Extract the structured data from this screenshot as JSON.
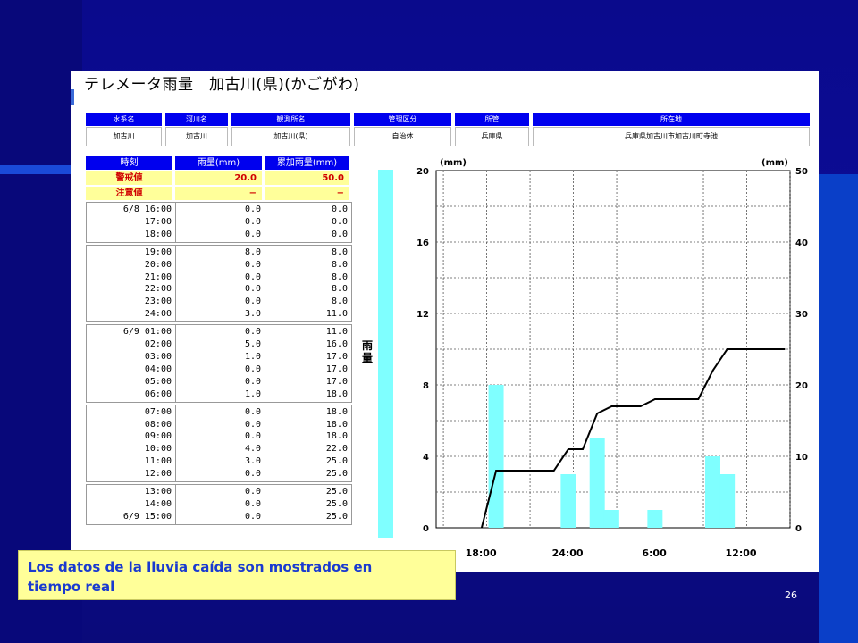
{
  "panel": {
    "title": "テレメータ雨量　加古川(県)(かごがわ)"
  },
  "station_info": {
    "headers": [
      "水系名",
      "河川名",
      "観測所名",
      "管理区分",
      "所管",
      "所在地"
    ],
    "values": [
      "加古川",
      "加古川",
      "加古川(県)",
      "自治体",
      "兵庫県",
      "兵庫県加古川市加古川町寺池"
    ]
  },
  "rain_table": {
    "headers": [
      "時刻",
      "雨量(mm)",
      "累加雨量(mm)"
    ],
    "warning": {
      "label": "警戒値",
      "rain": "20.0",
      "cumulative": "50.0"
    },
    "caution": {
      "label": "注意値",
      "rain": "−",
      "cumulative": "−"
    },
    "groups": [
      {
        "times": [
          "6/8 16:00",
          "17:00",
          "18:00"
        ],
        "rain": [
          "0.0",
          "0.0",
          "0.0"
        ],
        "cum": [
          "0.0",
          "0.0",
          "0.0"
        ]
      },
      {
        "times": [
          "19:00",
          "20:00",
          "21:00",
          "22:00",
          "23:00",
          "24:00"
        ],
        "rain": [
          "8.0",
          "0.0",
          "0.0",
          "0.0",
          "0.0",
          "3.0"
        ],
        "cum": [
          "8.0",
          "8.0",
          "8.0",
          "8.0",
          "8.0",
          "11.0"
        ]
      },
      {
        "times": [
          "6/9 01:00",
          "02:00",
          "03:00",
          "04:00",
          "05:00",
          "06:00"
        ],
        "rain": [
          "0.0",
          "5.0",
          "1.0",
          "0.0",
          "0.0",
          "1.0"
        ],
        "cum": [
          "11.0",
          "16.0",
          "17.0",
          "17.0",
          "17.0",
          "18.0"
        ]
      },
      {
        "times": [
          "07:00",
          "08:00",
          "09:00",
          "10:00",
          "11:00",
          "12:00"
        ],
        "rain": [
          "0.0",
          "0.0",
          "0.0",
          "4.0",
          "3.0",
          "0.0"
        ],
        "cum": [
          "18.0",
          "18.0",
          "18.0",
          "22.0",
          "25.0",
          "25.0"
        ]
      },
      {
        "times": [
          "13:00",
          "14:00",
          "6/9 15:00"
        ],
        "rain": [
          "0.0",
          "0.0",
          "0.0"
        ],
        "cum": [
          "25.0",
          "25.0",
          "25.0"
        ]
      }
    ]
  },
  "side_label": "雨量",
  "chart_data": {
    "type": "bar",
    "left_unit": "(mm)",
    "right_unit": "(mm)",
    "left_ylim": [
      0,
      20
    ],
    "right_ylim": [
      0,
      50
    ],
    "left_ticks": [
      0,
      4,
      8,
      12,
      16,
      20
    ],
    "right_ticks": [
      0,
      10,
      20,
      30,
      40,
      50
    ],
    "x_ticks": [
      "18:00",
      "24:00",
      "6:00",
      "12:00"
    ],
    "grid": true,
    "hours": [
      "16:00",
      "17:00",
      "18:00",
      "19:00",
      "20:00",
      "21:00",
      "22:00",
      "23:00",
      "24:00",
      "01:00",
      "02:00",
      "03:00",
      "04:00",
      "05:00",
      "06:00",
      "07:00",
      "08:00",
      "09:00",
      "10:00",
      "11:00",
      "12:00",
      "13:00",
      "14:00",
      "15:00"
    ],
    "series": [
      {
        "values": [
          0,
          0,
          0,
          8,
          0,
          0,
          0,
          0,
          3,
          0,
          5,
          1,
          0,
          0,
          1,
          0,
          0,
          0,
          4,
          3,
          0,
          0,
          0,
          0
        ],
        "color": "#7fffff"
      },
      {
        "values": [
          0,
          0,
          0,
          8,
          8,
          8,
          8,
          8,
          11,
          11,
          16,
          17,
          17,
          17,
          18,
          18,
          18,
          18,
          22,
          25,
          25,
          25,
          25,
          25
        ],
        "color": "#000000"
      }
    ]
  },
  "caption": {
    "line1": "Los datos de la lluvia caída son mostrados en",
    "line2": "tiempo real"
  },
  "page_number": "26"
}
